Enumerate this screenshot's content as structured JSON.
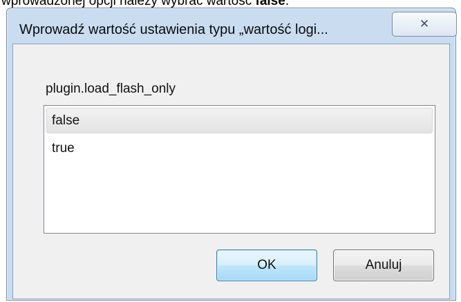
{
  "background": {
    "text_before": "wprowadzonej opcji należy wybrać wartość ",
    "text_bold": "false",
    "text_after": "."
  },
  "dialog": {
    "title": "Wprowadź wartość ustawienia typu „wartość logi...",
    "close_icon": "close-icon",
    "setting_name": "plugin.load_flash_only",
    "options": [
      "false",
      "true"
    ],
    "selected_value": "false",
    "ok_label": "OK",
    "cancel_label": "Anuluj"
  },
  "colors": {
    "frame": "#c9dcf0",
    "client": "#f0f0f0",
    "ok_border": "#3c7fb1"
  }
}
